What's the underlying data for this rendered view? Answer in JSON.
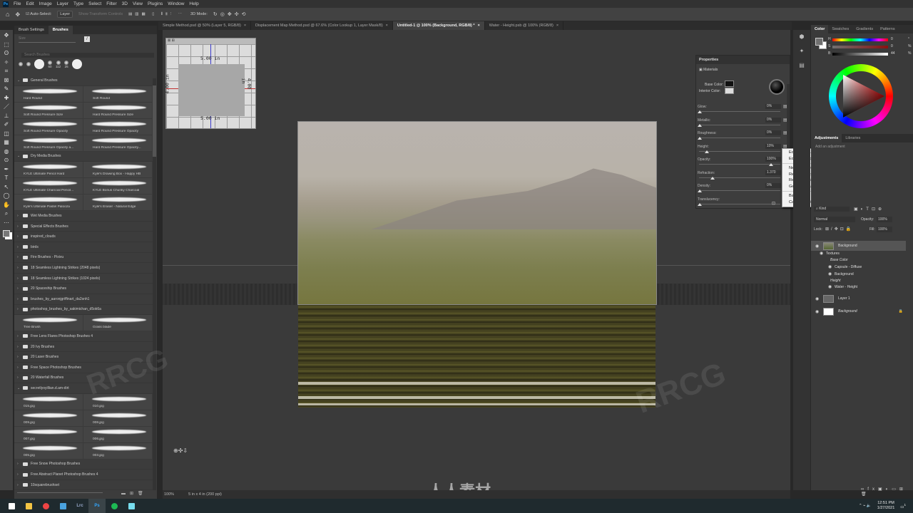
{
  "app": {
    "logo": "Ps"
  },
  "menu": [
    "File",
    "Edit",
    "Image",
    "Layer",
    "Type",
    "Select",
    "Filter",
    "3D",
    "View",
    "Plugins",
    "Window",
    "Help"
  ],
  "options": {
    "auto_select_label": "Auto-Select:",
    "auto_select_target": "Layer",
    "show_transform": "Show Transform Controls",
    "mode_3d": "3D Mode:"
  },
  "tabs": [
    {
      "label": "Simple Method.psd @ 50% (Layer 5, RGB/8)",
      "active": false
    },
    {
      "label": "Displacement Map Method.psd @ 67.6% (Color Lookup 1, Layer Mask/8)",
      "active": false
    },
    {
      "label": "Untitled-1 @ 100% (Background, RGB/8) *",
      "active": true
    },
    {
      "label": "Water - Height.psb @ 100% (RGB/8)",
      "active": false
    }
  ],
  "brushes": {
    "tabs": [
      "Brush Settings",
      "Brushes"
    ],
    "active_tab": "Brushes",
    "size_label": "Size",
    "search_placeholder": "Search Brushes",
    "presets": [
      "",
      "",
      "",
      "60",
      "112",
      "25",
      ""
    ],
    "items": [
      {
        "type": "folder",
        "label": "General Brushes",
        "open": true
      },
      {
        "type": "pair",
        "left": "Hard Round",
        "right": "Soft Round"
      },
      {
        "type": "pair",
        "left": "Soft Round Pressure Size",
        "right": "Hard Round Pressure Size"
      },
      {
        "type": "pair",
        "left": "Soft Round Pressure Opacity",
        "right": "Hard Round Pressure Opacity"
      },
      {
        "type": "pair",
        "left": "Soft Round Pressure Opacity a...",
        "right": "Hard Round Pressure Opacity..."
      },
      {
        "type": "folder",
        "label": "Dry Media Brushes",
        "open": true
      },
      {
        "type": "pair",
        "left": "KYLE Ultimate Pencil Hard",
        "right": "Kyle's Drawing Box - Happy HB"
      },
      {
        "type": "pair",
        "left": "KYLE Ultimate Charcoal Pencil...",
        "right": "KYLE Bonus Chunky Charcoal"
      },
      {
        "type": "pair",
        "left": "Kyle's Ultimate Pastel Palooza",
        "right": "Kyle's Eraser - Natural Edge"
      },
      {
        "type": "folder",
        "label": "Wet Media Brushes",
        "open": false
      },
      {
        "type": "folder",
        "label": "Special Effects Brushes",
        "open": false
      },
      {
        "type": "folder",
        "label": "inspired_clouds",
        "open": false
      },
      {
        "type": "folder",
        "label": "birds",
        "open": false
      },
      {
        "type": "folder",
        "label": "Fire Brushes - Pixivu",
        "open": false
      },
      {
        "type": "folder",
        "label": "18 Seamless Lightning Strikes (2048 pixels)",
        "open": false
      },
      {
        "type": "folder",
        "label": "18 Seamless Lightning Strikes (1024 pixels)",
        "open": false
      },
      {
        "type": "folder",
        "label": "20 Spaceship Brushes",
        "open": false
      },
      {
        "type": "folder",
        "label": "brushes_by_aaronjgriffinart_da2snh1",
        "open": false
      },
      {
        "type": "folder",
        "label": "photoshop_brushes_by_sakimichan_d5ok6a",
        "open": false
      },
      {
        "type": "pair",
        "left": "Tree Brush",
        "right": "Grass blade"
      },
      {
        "type": "folder",
        "label": "Free Lens Flares Photoshop Brushes 4",
        "open": false
      },
      {
        "type": "folder",
        "label": "20 Ivy Brushes",
        "open": false
      },
      {
        "type": "folder",
        "label": "20 Laser Brushes",
        "open": false
      },
      {
        "type": "folder",
        "label": "Free Space Photoshop Brushes",
        "open": false
      },
      {
        "type": "folder",
        "label": "20 Waterfall  Brushes",
        "open": false
      },
      {
        "type": "folder",
        "label": "secretlyoyillian.d.am-dirt",
        "open": true
      },
      {
        "type": "pair",
        "left": "015.jpg",
        "right": "010.jpg"
      },
      {
        "type": "pair",
        "left": "009.jpg",
        "right": "008.jpg"
      },
      {
        "type": "pair",
        "left": "007.jpg",
        "right": "006.jpg"
      },
      {
        "type": "pair",
        "left": "005.jpg",
        "right": "003.jpg"
      },
      {
        "type": "folder",
        "label": "Free Snow Photoshop Brushes",
        "open": false
      },
      {
        "type": "folder",
        "label": "Free Abstract Planet Photoshop Brushes 4",
        "open": false
      },
      {
        "type": "folder",
        "label": "10squarebrushset",
        "open": false
      }
    ]
  },
  "navigator": {
    "top": "5.00 in",
    "bottom": "5.00 in",
    "left": "4.00 in",
    "right": "4.00 in"
  },
  "properties": {
    "title": "Properties",
    "section": "Materials",
    "base_color_label": "Base Color:",
    "interior_color_label": "Interior Color:",
    "rows": [
      {
        "label": "Glow:",
        "value": "0%",
        "level": 0
      },
      {
        "label": "Metallic:",
        "value": "0%",
        "level": 0
      },
      {
        "label": "Roughness:",
        "value": "0%",
        "level": 0
      },
      {
        "label": "Height:",
        "value": "10%",
        "level": 0.1
      },
      {
        "label": "Opacity:",
        "value": "100%",
        "level": 1
      },
      {
        "label": "Refraction:",
        "value": "1.370",
        "level": 0.18
      },
      {
        "label": "Density:",
        "value": "0%",
        "level": 0
      },
      {
        "label": "Translucency:",
        "value": "",
        "level": 0
      }
    ]
  },
  "context_menu": {
    "groups": [
      [
        "Edit Texture...",
        "Edit UV Properties..."
      ],
      [
        "New Texture...",
        "Replace Texture...",
        "Remove Texture",
        "Generate Bumps (Height) From Base Color..."
      ],
      [
        "Background",
        "Capsule - Diffuse"
      ]
    ]
  },
  "color_panel": {
    "tabs": [
      "Color",
      "Swatches",
      "Gradients",
      "Patterns"
    ],
    "active_tab": "Color",
    "sliders": [
      {
        "label": "H",
        "value": "0",
        "unit": "°"
      },
      {
        "label": "S",
        "value": "0",
        "unit": "%"
      },
      {
        "label": "B",
        "value": "44",
        "unit": "%"
      }
    ]
  },
  "adjustments": {
    "tabs": [
      "Adjustments",
      "Libraries"
    ],
    "active_tab": "Adjustments",
    "hint": "Add an adjustment"
  },
  "layers": {
    "filter": "Kind",
    "blend_mode": "Normal",
    "opacity_label": "Opacity:",
    "opacity": "100%",
    "lock_label": "Lock:",
    "fill_label": "Fill:",
    "fill": "100%",
    "rows": [
      {
        "name": "Background",
        "kind": "3d",
        "indent": 0,
        "eye": true,
        "selected": true
      },
      {
        "name": "Textures",
        "kind": "group",
        "indent": 1,
        "eye": true
      },
      {
        "name": "Base Color",
        "kind": "label",
        "indent": 2,
        "eye": false
      },
      {
        "name": "Capsule - Diffuse",
        "kind": "tex",
        "indent": 3,
        "eye": true
      },
      {
        "name": "Background",
        "kind": "tex",
        "indent": 3,
        "eye": true
      },
      {
        "name": "Height",
        "kind": "label",
        "indent": 2,
        "eye": false
      },
      {
        "name": "Water - Height",
        "kind": "tex",
        "indent": 3,
        "eye": true
      },
      {
        "name": "Layer 1",
        "kind": "layer",
        "indent": 0,
        "eye": true
      },
      {
        "name": "Background",
        "kind": "bg",
        "indent": 0,
        "eye": true
      }
    ]
  },
  "status": {
    "zoom": "100%",
    "doc_info": "5 in x 4 in (200 ppi)"
  },
  "taskbar": {
    "apps": [
      "start",
      "file-explorer",
      "chrome",
      "mail",
      "Lrc",
      "Ps",
      "spotify",
      "discord"
    ],
    "time": "12:51 PM",
    "date": "1/27/2021",
    "notifications": "1"
  },
  "watermark": [
    "RRCG",
    "人人素材"
  ]
}
